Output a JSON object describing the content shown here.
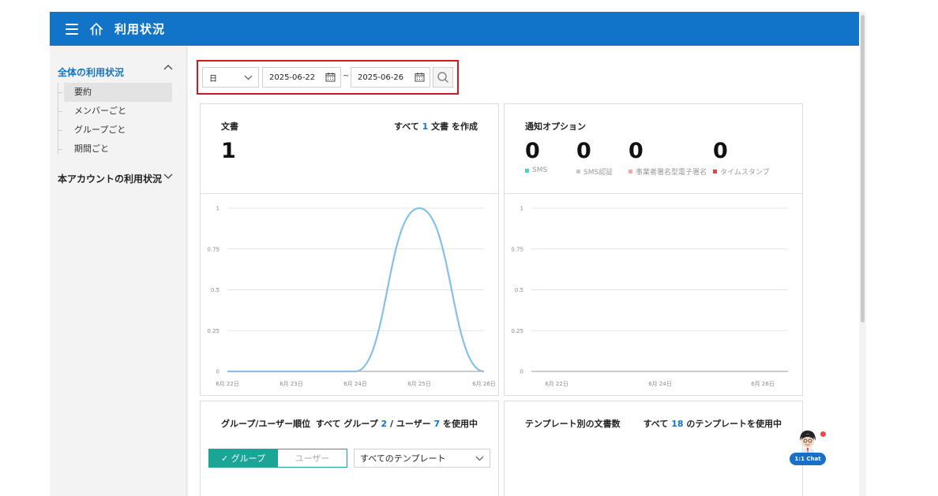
{
  "header": {
    "title": "利用状況"
  },
  "sidebar": {
    "section1": {
      "label": "全体の利用状況",
      "items": [
        "要約",
        "メンバーごと",
        "グループごと",
        "期間ごと"
      ]
    },
    "section2": {
      "label": "本アカウントの利用状況"
    }
  },
  "filter": {
    "period": "日",
    "start_date": "2025-06-22",
    "separator": "~",
    "end_date": "2025-06-26"
  },
  "documents_card": {
    "title": "文書",
    "count": "1",
    "summary_pre": "すべて ",
    "summary_num": "1",
    "summary_post": " 文書 を作成"
  },
  "notify_card": {
    "title": "通知オプション",
    "values": [
      "0",
      "0",
      "0",
      "0"
    ],
    "legend": [
      {
        "label": "SMS",
        "color": "#4fd1c1"
      },
      {
        "label": "SMS認証",
        "color": "#c8c8c8"
      },
      {
        "label": "事業者署名型電子署名",
        "color": "#f3a9a3"
      },
      {
        "label": "タイムスタンプ",
        "color": "#e5434b"
      }
    ]
  },
  "ranking_card": {
    "title": "グループ/ユーザー順位",
    "summary_pre": "すべて グループ ",
    "summary_num1": "2",
    "summary_mid": " / ユーザー ",
    "summary_num2": "7",
    "summary_post": " を使用中",
    "toggle_group": "✓ グループ",
    "toggle_user": "ユーザー",
    "template_select": "すべてのテンプレート"
  },
  "template_card": {
    "title": "テンプレート別の文書数",
    "summary_pre": "すべて ",
    "summary_num": "18",
    "summary_post": " のテンプレートを使用中"
  },
  "chat": {
    "label": "1:1 Chat"
  },
  "chart_data": [
    {
      "type": "line",
      "x": [
        "6月 22日",
        "6月 23日",
        "6月 24日",
        "6月 25日",
        "6月 26日"
      ],
      "series": [
        {
          "values": [
            0,
            0,
            0,
            1,
            0
          ],
          "color": "#84c0ea"
        }
      ],
      "y_ticks": [
        "0",
        "0.25",
        "0.5",
        "0.75",
        "1"
      ],
      "ylim": [
        0,
        1
      ],
      "grid": true
    },
    {
      "type": "line",
      "x": [
        "6月 22日",
        "6月 24日",
        "6月 26日"
      ],
      "series": [],
      "y_ticks": [
        "0",
        "0.25",
        "0.5",
        "0.75",
        "1"
      ],
      "ylim": [
        0,
        1
      ],
      "grid": true
    }
  ]
}
